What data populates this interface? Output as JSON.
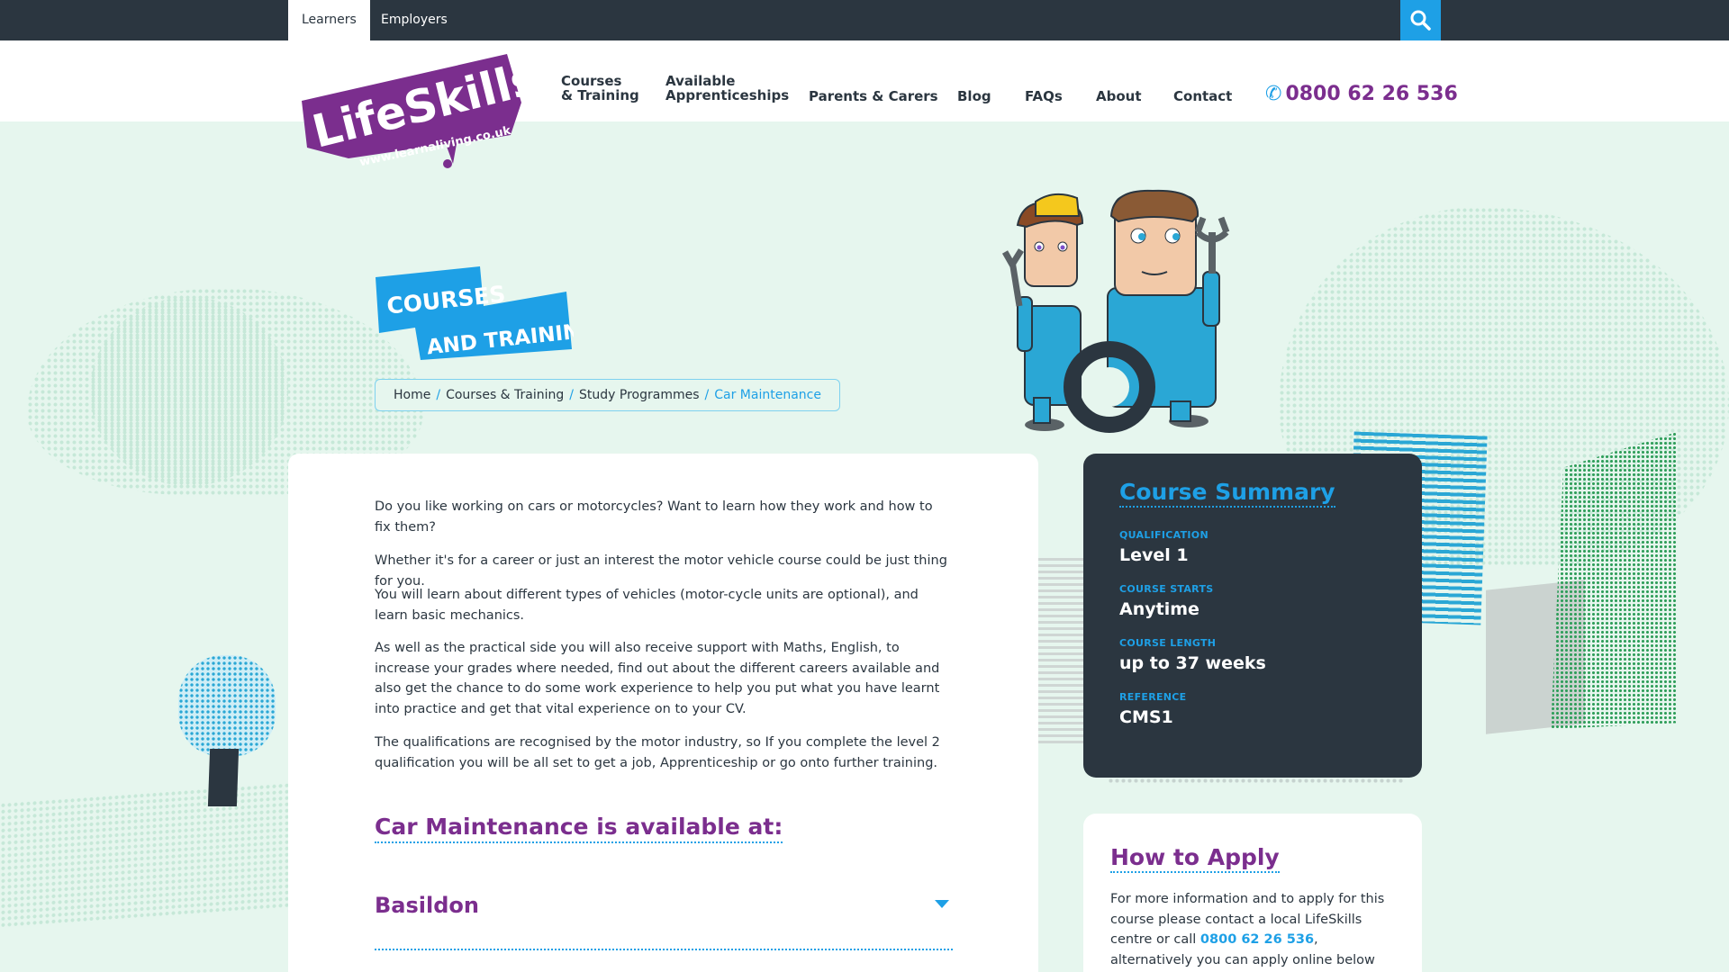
{
  "topbar": {
    "tabs": [
      "Learners",
      "Employers"
    ],
    "active_tab": "Learners"
  },
  "brand": {
    "logo_text": "LifeSkills",
    "logo_url_text": "www.learnaliving.co.uk",
    "colors": {
      "purple": "#7b2e8e",
      "blue": "#1ea0e6",
      "dark": "#2b3640",
      "mint": "#e6f6ee"
    }
  },
  "nav": {
    "courses_line1": "Courses",
    "courses_line2": "& Training",
    "appr_line1": "Available",
    "appr_line2": "Apprenticeships",
    "parents": "Parents & Carers",
    "blog": "Blog",
    "faqs": "FAQs",
    "about": "About",
    "contact": "Contact",
    "phone": "0800 62 26 536"
  },
  "hero": {
    "badge_line1": "COURSES",
    "badge_line2": "AND TRAINING",
    "breadcrumb": [
      "Home",
      "Courses & Training",
      "Study Programmes",
      "Car Maintenance"
    ]
  },
  "main": {
    "paragraphs": [
      "Do you like working on cars or motorcycles? Want to learn how they work and how to fix them?",
      "Whether it's for a career or just an interest the motor vehicle course could be just thing for you.",
      "You will learn about different types of vehicles (motor-cycle units are optional), and learn basic mechanics.",
      "As well as the practical side you will also receive support with Maths, English, to increase your grades where needed, find out about the different careers available and also get the chance to do some work experience to help you put what you have learnt into practice and get that vital experience on to your CV.",
      "The qualifications are recognised by the motor industry, so If you complete the level 2 qualification you will be all set to get a job, Apprenticeship or go onto further training."
    ],
    "available_title": "Car Maintenance is available at:",
    "locations": [
      "Basildon"
    ]
  },
  "summary": {
    "title": "Course Summary",
    "items": [
      {
        "label": "QUALIFICATION",
        "value": "Level 1"
      },
      {
        "label": "COURSE STARTS",
        "value": "Anytime"
      },
      {
        "label": "COURSE LENGTH",
        "value": "up to 37 weeks"
      },
      {
        "label": "REFERENCE",
        "value": "CMS1"
      }
    ]
  },
  "apply": {
    "title": "How to Apply",
    "text_before": "For more information and to apply for this course please contact a local LifeSkills centre or call ",
    "phone": "0800 62 26 536",
    "text_after": ", alternatively you can apply online below and we'll get back to you."
  }
}
